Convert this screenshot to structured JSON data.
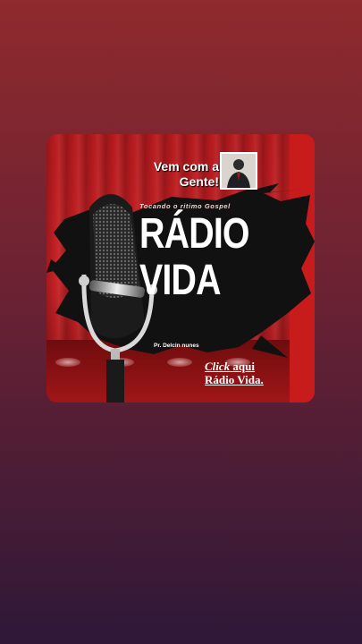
{
  "banner": {
    "tagline": "Vem com a Gente!",
    "subtitle": "Tocando o ritimo Gospel",
    "title_line1": "RÁDIO",
    "title_line2": "VIDA",
    "pastor": "Pr. Delcin nunes",
    "cta_word": "Click",
    "cta_rest": "aqui",
    "cta_line2": "Rádio Vida."
  },
  "colors": {
    "background_top": "#8f2a2d",
    "background_bottom": "#2e1838",
    "card_red": "#c42124"
  },
  "icons": {
    "microphone": "microphone-icon",
    "person_photo": "pastor-photo"
  }
}
